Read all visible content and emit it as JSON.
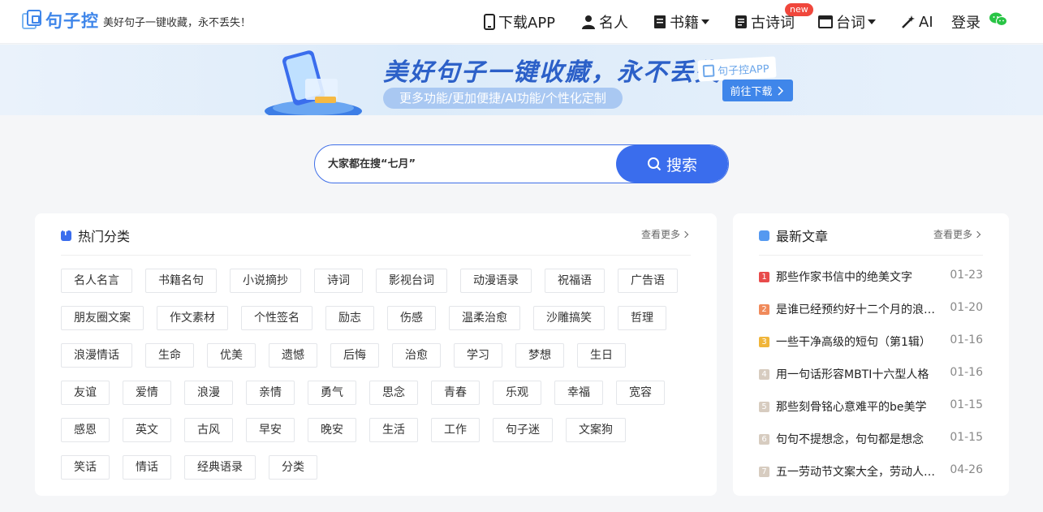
{
  "header": {
    "logo_text": "句子控",
    "slogan": "美好句子一键收藏，永不丢失！",
    "nav": {
      "download": "下载APP",
      "famous": "名人",
      "books": "书籍",
      "poems": "古诗词",
      "poems_badge": "new",
      "lines": "台词",
      "ai": "AI",
      "login": "登录"
    }
  },
  "banner": {
    "headline": "美好句子一键收藏，永不丢失！",
    "subline": "更多功能/更加便捷/AI功能/个性化定制",
    "app_tag": "句子控APP",
    "cta": "前往下载"
  },
  "search": {
    "placeholder": "大家都在搜“七月”",
    "button": "搜索"
  },
  "hot": {
    "title": "热门分类",
    "more": "查看更多",
    "rows": [
      [
        "名人名言",
        "书籍名句",
        "小说摘抄",
        "诗词",
        "影视台词",
        "动漫语录",
        "祝福语",
        "广告语"
      ],
      [
        "朋友圈文案",
        "作文素材",
        "个性签名",
        "励志",
        "伤感",
        "温柔治愈",
        "沙雕搞笑",
        "哲理"
      ],
      [
        "浪漫情话",
        "生命",
        "优美",
        "遗憾",
        "后悔",
        "治愈",
        "学习",
        "梦想",
        "生日"
      ],
      [
        "友谊",
        "爱情",
        "浪漫",
        "亲情",
        "勇气",
        "思念",
        "青春",
        "乐观",
        "幸福",
        "宽容"
      ],
      [
        "感恩",
        "英文",
        "古风",
        "早安",
        "晚安",
        "生活",
        "工作",
        "句子迷",
        "文案狗"
      ],
      [
        "笑话",
        "情话",
        "经典语录",
        "分类"
      ]
    ]
  },
  "news": {
    "title": "最新文章",
    "more": "查看更多",
    "items": [
      {
        "num": "1",
        "title": "那些作家书信中的绝美文字",
        "date": "01-23",
        "color": "#e84b4b"
      },
      {
        "num": "2",
        "title": "是谁已经预约好十二个月的浪漫了",
        "date": "01-20",
        "color": "#f08a5b"
      },
      {
        "num": "3",
        "title": "一些干净高级的短句（第1辑）",
        "date": "01-16",
        "color": "#f0b53a"
      },
      {
        "num": "4",
        "title": "用一句话形容MBTI十六型人格",
        "date": "01-16",
        "color": "#d7ccc0"
      },
      {
        "num": "5",
        "title": "那些刻骨铭心意难平的be美学",
        "date": "01-15",
        "color": "#d7ccc0"
      },
      {
        "num": "6",
        "title": "句句不提想念，句句都是想念",
        "date": "01-15",
        "color": "#d7ccc0"
      },
      {
        "num": "7",
        "title": "五一劳动节文案大全，劳动人民最光荣",
        "date": "04-26",
        "color": "#d7ccc0"
      }
    ]
  },
  "colors": {
    "accent": "#3a6ded",
    "brand": "#3f86ea",
    "badge": "#f0473c"
  }
}
